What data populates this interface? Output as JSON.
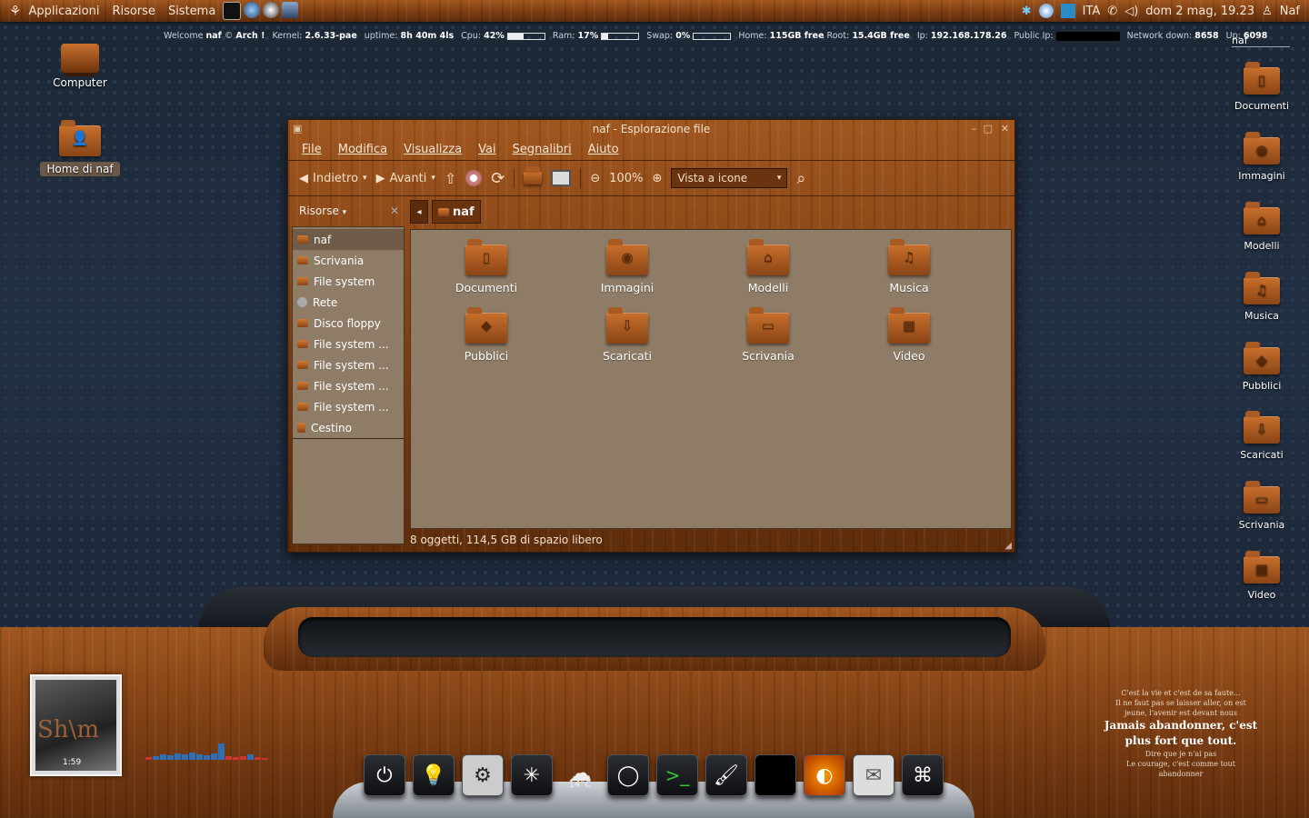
{
  "panel": {
    "menus": [
      "Applicazioni",
      "Risorse",
      "Sistema"
    ],
    "keyboard": "ITA",
    "clock": "dom  2 mag, 19.23",
    "user": "Naf"
  },
  "conky": {
    "welcome": "Welcome",
    "user": "naf",
    "distro": "Arch !",
    "kernel_label": "Kernel:",
    "kernel": "2.6.33-pae",
    "uptime_label": "uptime:",
    "uptime": "8h 40m 4ls",
    "cpu_label": "Cpu:",
    "cpu": "42%",
    "cpu_level": 0.42,
    "ram_label": "Ram:",
    "ram": "17%",
    "ram_level": 0.17,
    "swap_label": "Swap:",
    "swap": "0%",
    "swap_level": 0,
    "home_label": "Home:",
    "home": "115GB free",
    "root_label": "Root:",
    "root": "15.4GB free",
    "ip_label": "Ip:",
    "ip": "192.168.178.26",
    "public_label": "Public Ip:",
    "down_label": "Network down:",
    "down": "8658",
    "up_label": "Up:",
    "up": "6098"
  },
  "search_text": "naf",
  "desktop_left": [
    {
      "label": "Computer",
      "icon": "computer-icon"
    },
    {
      "label": "Home di naf",
      "icon": "home-folder-icon"
    }
  ],
  "desktop_right": [
    {
      "label": "Documenti",
      "icon": "documents-folder-icon"
    },
    {
      "label": "Immagini",
      "icon": "pictures-folder-icon"
    },
    {
      "label": "Modelli",
      "icon": "templates-folder-icon"
    },
    {
      "label": "Musica",
      "icon": "music-folder-icon"
    },
    {
      "label": "Pubblici",
      "icon": "public-folder-icon"
    },
    {
      "label": "Scaricati",
      "icon": "downloads-folder-icon"
    },
    {
      "label": "Scrivania",
      "icon": "desktop-folder-icon"
    },
    {
      "label": "Video",
      "icon": "videos-folder-icon"
    }
  ],
  "window": {
    "title": "naf - Esplorazione file",
    "menu": [
      "File",
      "Modifica",
      "Visualizza",
      "Vai",
      "Segnalibri",
      "Aiuto"
    ],
    "back": "Indietro",
    "forward": "Avanti",
    "zoom": "100%",
    "view_mode": "Vista a icone",
    "sidebar_title": "Risorse",
    "sidebar": [
      "naf",
      "Scrivania",
      "File system",
      "Rete",
      "Disco floppy",
      "File system ...",
      "File system ...",
      "File system ...",
      "File system ...",
      "Cestino"
    ],
    "path": "naf",
    "files": [
      "Documenti",
      "Immagini",
      "Modelli",
      "Musica",
      "Pubblici",
      "Scaricati",
      "Scrivania",
      "Video"
    ],
    "status": "8 oggetti, 114,5 GB di spazio libero"
  },
  "player": {
    "time": "1:59"
  },
  "weather": "14°C",
  "quote": {
    "l1": "C'est la vie et c'est de sa faute...",
    "l2": "Il ne faut pas se laisser aller, on est",
    "l3": "jeune, l'avenir est devant nous",
    "bold": "Jamais abandonner, c'est plus fort que tout.",
    "l4": "Dire que je n'ai pas",
    "l5": "Le courage, c'est comme tout",
    "l6": "abandonner"
  },
  "colors": {
    "wood": "#8a4414",
    "content_bg": "#8e7c66",
    "desktop_bg": "#1f2b3a"
  }
}
